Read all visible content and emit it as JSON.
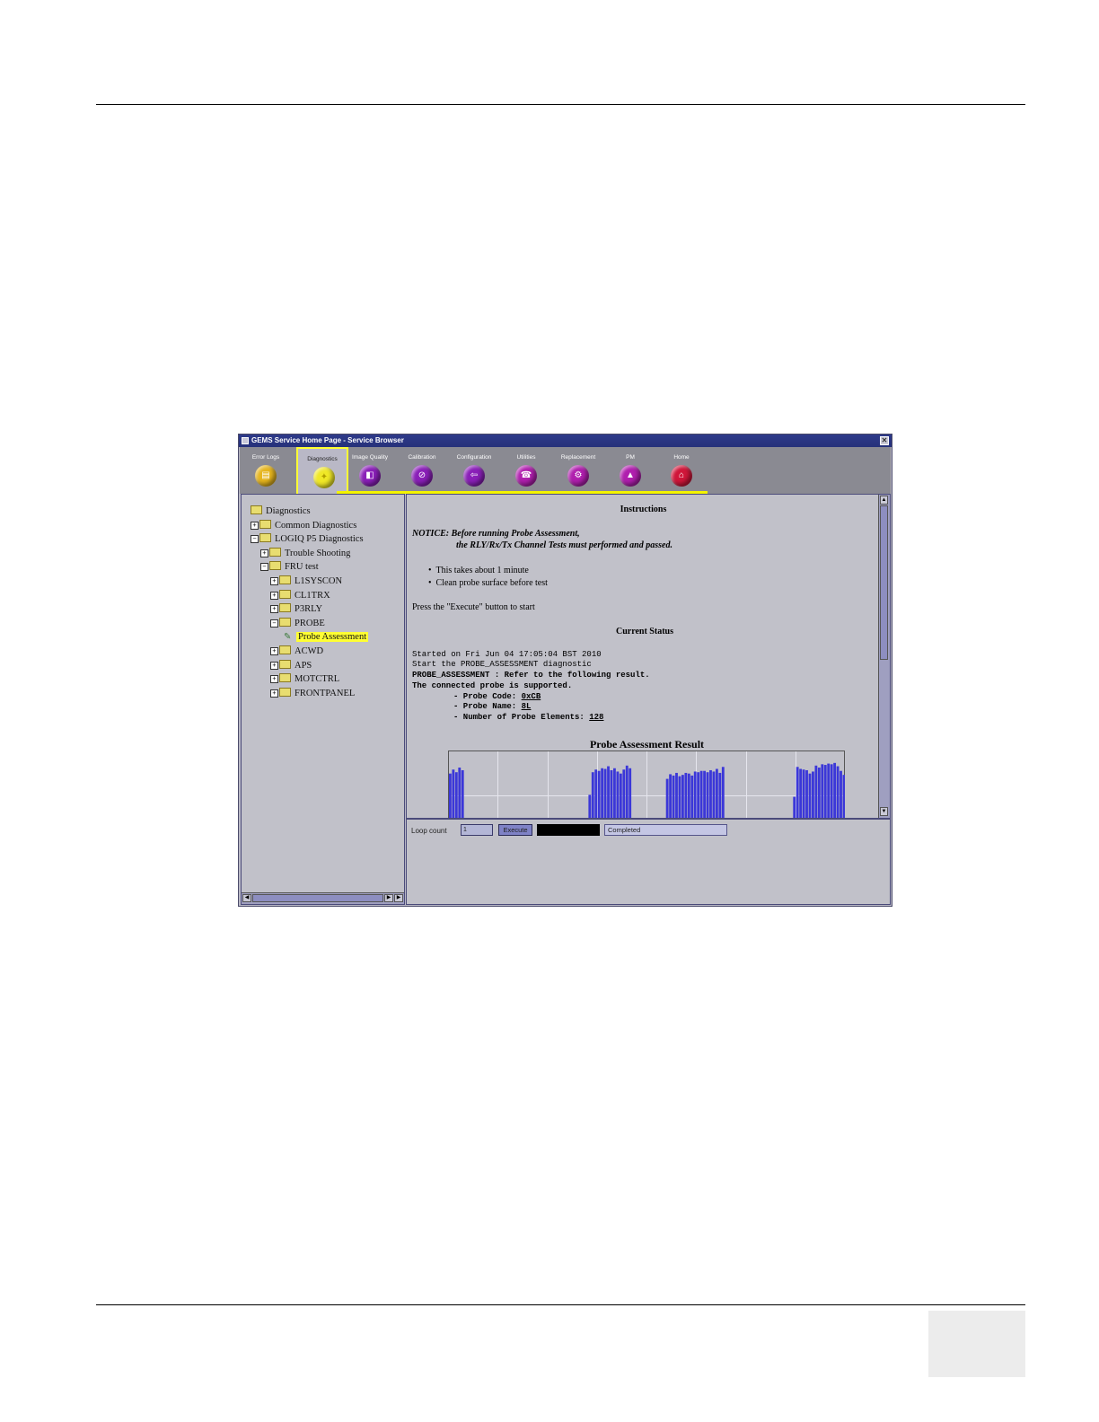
{
  "window": {
    "title": "GEMS Service Home Page - Service Browser",
    "close_glyph": "✕"
  },
  "toolbar": {
    "tabs": [
      {
        "label": "Error Logs",
        "color": "#e6b51e",
        "glyph": "▤"
      },
      {
        "label": "Diagnostics",
        "color": "#f0e827",
        "glyph": "✦"
      },
      {
        "label": "Image Quality",
        "color": "#8a1fb8",
        "glyph": "◧"
      },
      {
        "label": "Calibration",
        "color": "#8a1fb8",
        "glyph": "⊘"
      },
      {
        "label": "Configuration",
        "color": "#8a1fb8",
        "glyph": "⇦"
      },
      {
        "label": "Utilities",
        "color": "#b01fae",
        "glyph": "☎"
      },
      {
        "label": "Replacement",
        "color": "#b01fae",
        "glyph": "⚙"
      },
      {
        "label": "PM",
        "color": "#b01fae",
        "glyph": "▲"
      },
      {
        "label": "Home",
        "color": "#d0163a",
        "glyph": "⌂"
      }
    ]
  },
  "tree": {
    "items": [
      {
        "label": "Diagnostics",
        "expander": ""
      },
      {
        "label": "Common Diagnostics",
        "expander": "+"
      },
      {
        "label": "LOGIQ P5 Diagnostics",
        "expander": "−"
      },
      {
        "label": "Trouble Shooting",
        "expander": "+"
      },
      {
        "label": "FRU test",
        "expander": "−"
      },
      {
        "label": "L1SYSCON",
        "expander": "+"
      },
      {
        "label": "CL1TRX",
        "expander": "+"
      },
      {
        "label": "P3RLY",
        "expander": "+"
      },
      {
        "label": "PROBE",
        "expander": "−"
      },
      {
        "label": "Probe Assessment",
        "expander": ""
      },
      {
        "label": "ACWD",
        "expander": "+"
      },
      {
        "label": "APS",
        "expander": "+"
      },
      {
        "label": "MOTCTRL",
        "expander": "+"
      },
      {
        "label": "FRONTPANEL",
        "expander": "+"
      }
    ]
  },
  "content": {
    "instructions_title": "Instructions",
    "notice_line1": "NOTICE: Before running Probe Assessment,",
    "notice_line2": "the RLY/Rx/Tx Channel Tests must performed and passed.",
    "bullets": [
      "This takes about 1 minute",
      "Clean probe surface before test"
    ],
    "press_text": "Press the \"Execute\" button to start",
    "status_title": "Current Status",
    "status_lines": [
      "Started on Fri Jun 04 17:05:04 BST 2010",
      "Start the PROBE_ASSESSMENT diagnostic"
    ],
    "result_line": "PROBE_ASSESSMENT : Refer to the following result.",
    "supported_line": "The connected probe is supported.",
    "probe_code_label": "- Probe Code:",
    "probe_code_value": "0xCB",
    "probe_name_label": "- Probe Name:",
    "probe_name_value": "8L",
    "probe_elements_label": "- Number of Probe Elements:",
    "probe_elements_value": "128"
  },
  "chart_data": {
    "type": "bar",
    "title": "Probe Assessment Result",
    "x_count": 128,
    "grid": true,
    "bar_color": "#3b37d8",
    "clusters": [
      {
        "start": 0,
        "values": [
          0.68,
          0.74,
          0.7,
          0.77,
          0.73
        ]
      },
      {
        "start": 45,
        "values": [
          0.36,
          0.7,
          0.74,
          0.72,
          0.76,
          0.75,
          0.79,
          0.73,
          0.76,
          0.71,
          0.68,
          0.74,
          0.8,
          0.76
        ]
      },
      {
        "start": 70,
        "values": [
          0.6,
          0.67,
          0.65,
          0.69,
          0.64,
          0.66,
          0.69,
          0.68,
          0.65,
          0.71,
          0.7,
          0.72,
          0.72,
          0.7,
          0.73,
          0.71,
          0.75,
          0.69,
          0.78
        ]
      },
      {
        "start": 111,
        "values": [
          0.33,
          0.78,
          0.75,
          0.74,
          0.73,
          0.68,
          0.71,
          0.8,
          0.77,
          0.82,
          0.81,
          0.83,
          0.82,
          0.84,
          0.79,
          0.72,
          0.66,
          0.92
        ]
      }
    ]
  },
  "controls": {
    "loop_label": "Loop count",
    "loop_value": "1",
    "execute_label": "Execute",
    "status_value": "Completed"
  },
  "scroll": {
    "up": "▲",
    "down": "▼",
    "left": "◀",
    "right": "▶"
  }
}
